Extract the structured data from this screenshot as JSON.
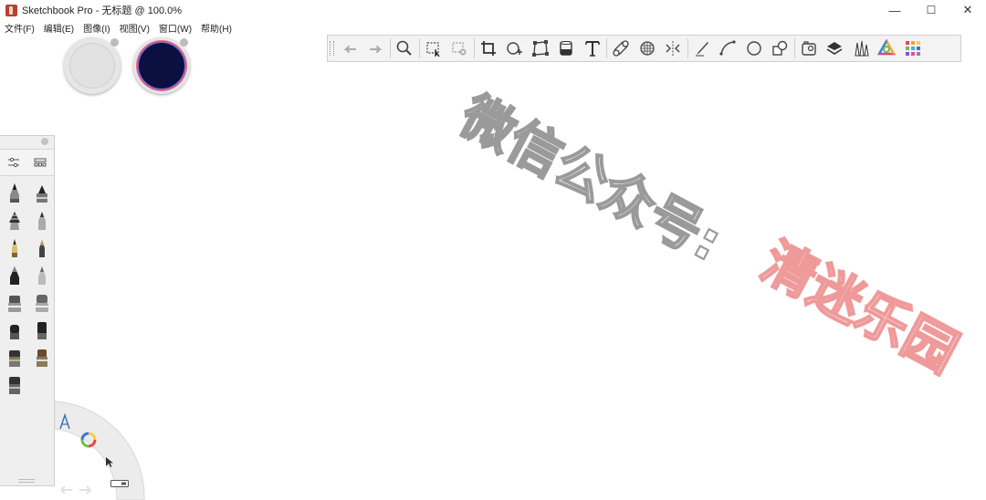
{
  "window": {
    "title": "Sketchbook Pro - 无标题 @ 100.0%",
    "controls": [
      "—",
      "☐",
      "✕"
    ]
  },
  "menu": [
    "文件(F)",
    "编辑(E)",
    "图像(I)",
    "视图(V)",
    "窗口(W)",
    "帮助(H)"
  ],
  "colors": {
    "primary_color": "#e2e2e2",
    "secondary_color": "#0a1140"
  },
  "toolbar": {
    "tools": [
      "undo-icon",
      "redo-icon",
      "zoom-icon",
      "lasso-select-icon",
      "magic-wand-icon",
      "crop-icon",
      "move-rotate-icon",
      "distort-icon",
      "fill-icon",
      "text-icon",
      "ruler-icon",
      "perspective-icon",
      "symmetry-icon",
      "pen-icon",
      "curve-icon",
      "ellipse-icon",
      "shapes-icon",
      "image-import-icon",
      "layers-icon",
      "brushes-icon",
      "color-wheel-icon",
      "palette-icon"
    ]
  },
  "brushpanel": {
    "brushes": [
      "pencil",
      "ballpoint",
      "airbrush",
      "marker",
      "pen",
      "chisel",
      "inking-pen",
      "hard-eraser",
      "paint-brush",
      "smear",
      "felt-tip",
      "highlighter",
      "round-brush",
      "flat-brush",
      "wide-brush"
    ]
  },
  "watermark": {
    "line1": "微信公众号:",
    "line2": "清迷乐园"
  }
}
